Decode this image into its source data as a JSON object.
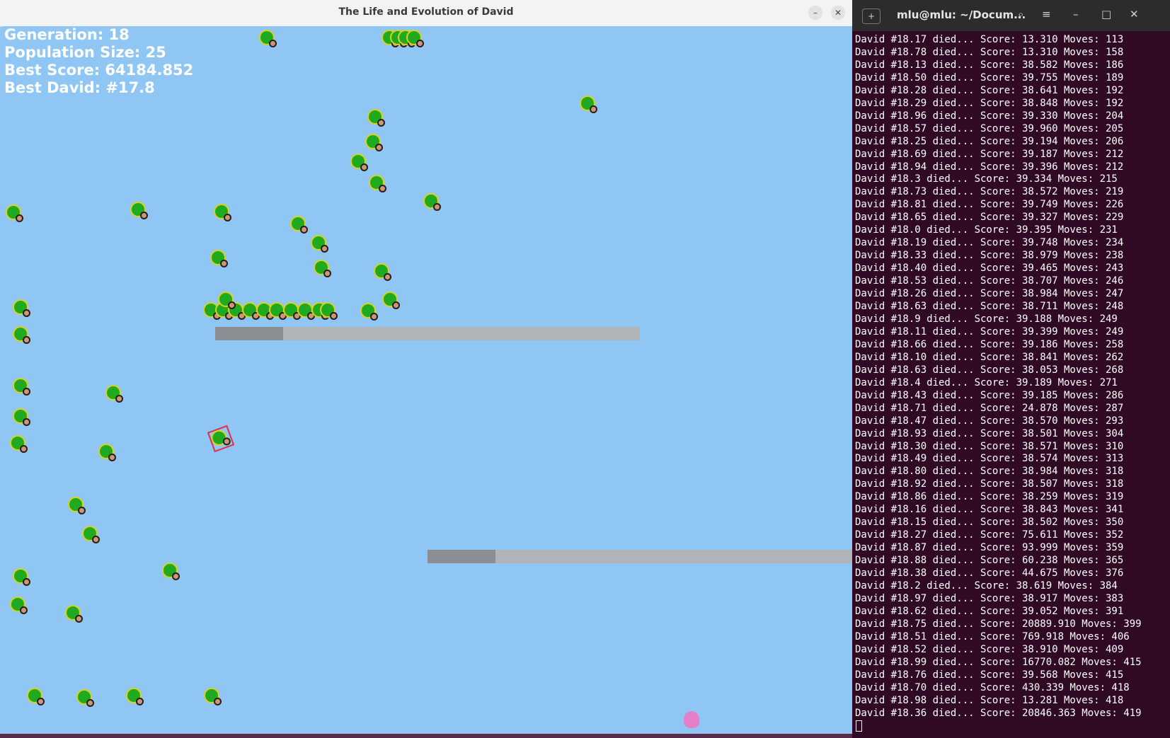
{
  "game": {
    "title": "The Life and Evolution of David",
    "minimize_glyph": "–",
    "close_glyph": "✕",
    "hud": {
      "generation": "Generation: 18",
      "population": "Population Size: 25",
      "best_score": "Best Score: 64184.852",
      "best_david": "Best David: #17.8"
    },
    "colors": {
      "sky": "#8fc6f3",
      "david_body": "#1faa1f",
      "platform": "#b0b3b8"
    }
  },
  "terminal": {
    "title": "mlu@mlu: ~/Docum...",
    "icons": [
      "new-tab-icon",
      "search-icon",
      "menu-icon",
      "minimize-icon",
      "maximize-icon",
      "close-icon"
    ],
    "lines": [
      "David #18.17 died... Score: 13.310 Moves: 113",
      "David #18.78 died... Score: 13.310 Moves: 158",
      "David #18.13 died... Score: 38.582 Moves: 186",
      "David #18.50 died... Score: 39.755 Moves: 189",
      "David #18.28 died... Score: 38.641 Moves: 192",
      "David #18.29 died... Score: 38.848 Moves: 192",
      "David #18.96 died... Score: 39.330 Moves: 204",
      "David #18.57 died... Score: 39.960 Moves: 205",
      "David #18.25 died... Score: 39.194 Moves: 206",
      "David #18.69 died... Score: 39.187 Moves: 212",
      "David #18.94 died... Score: 39.396 Moves: 212",
      "David #18.3 died... Score: 39.334 Moves: 215",
      "David #18.73 died... Score: 38.572 Moves: 219",
      "David #18.81 died... Score: 39.749 Moves: 226",
      "David #18.65 died... Score: 39.327 Moves: 229",
      "David #18.0 died... Score: 39.395 Moves: 231",
      "David #18.19 died... Score: 39.748 Moves: 234",
      "David #18.33 died... Score: 38.979 Moves: 238",
      "David #18.40 died... Score: 39.465 Moves: 243",
      "David #18.53 died... Score: 38.707 Moves: 246",
      "David #18.26 died... Score: 38.984 Moves: 247",
      "David #18.63 died... Score: 38.711 Moves: 248",
      "David #18.9 died... Score: 39.188 Moves: 249",
      "David #18.11 died... Score: 39.399 Moves: 249",
      "David #18.66 died... Score: 39.186 Moves: 258",
      "David #18.10 died... Score: 38.841 Moves: 262",
      "David #18.63 died... Score: 38.053 Moves: 268",
      "David #18.4 died... Score: 39.189 Moves: 271",
      "David #18.43 died... Score: 39.185 Moves: 286",
      "David #18.71 died... Score: 24.878 Moves: 287",
      "David #18.47 died... Score: 38.570 Moves: 293",
      "David #18.93 died... Score: 38.501 Moves: 304",
      "David #18.30 died... Score: 38.571 Moves: 310",
      "David #18.49 died... Score: 38.574 Moves: 313",
      "David #18.80 died... Score: 38.984 Moves: 318",
      "David #18.92 died... Score: 38.507 Moves: 318",
      "David #18.86 died... Score: 38.259 Moves: 319",
      "David #18.16 died... Score: 38.843 Moves: 341",
      "David #18.15 died... Score: 38.502 Moves: 350",
      "David #18.27 died... Score: 75.611 Moves: 352",
      "David #18.87 died... Score: 93.999 Moves: 359",
      "David #18.88 died... Score: 60.238 Moves: 365",
      "David #18.38 died... Score: 44.675 Moves: 376",
      "David #18.2 died... Score: 38.619 Moves: 384",
      "David #18.97 died... Score: 38.917 Moves: 383",
      "David #18.62 died... Score: 39.052 Moves: 391",
      "David #18.75 died... Score: 20889.910 Moves: 399",
      "David #18.51 died... Score: 769.918 Moves: 406",
      "David #18.52 died... Score: 38.910 Moves: 409",
      "David #18.99 died... Score: 16770.082 Moves: 415",
      "David #18.76 died... Score: 39.568 Moves: 415",
      "David #18.70 died... Score: 430.339 Moves: 418",
      "David #18.98 died... Score: 13.281 Moves: 418",
      "David #18.36 died... Score: 20846.363 Moves: 419"
    ]
  }
}
